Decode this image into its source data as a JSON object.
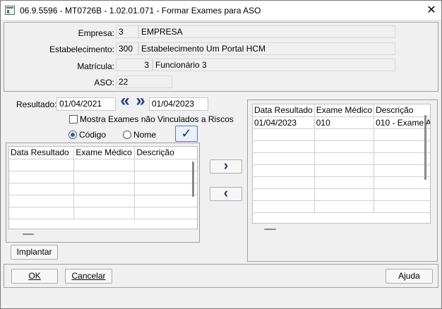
{
  "window": {
    "title": "06.9.5596 - MT0726B - 1.02.01.071 - Formar Exames para ASO"
  },
  "header": {
    "empresa_label": "Empresa:",
    "empresa_code": "3",
    "empresa_name": "EMPRESA",
    "estab_label": "Estabelecimento:",
    "estab_code": "300",
    "estab_name": "Estabelecimento Um Portal HCM",
    "matricula_label": "Matrícula:",
    "matricula_code": "3",
    "matricula_name": "Funcionário 3",
    "aso_label": "ASO:",
    "aso_value": "22"
  },
  "filter": {
    "resultado_label": "Resultado:",
    "date_from": "01/04/2021",
    "date_to": "01/04/2023",
    "prev_glyph": "«",
    "next_glyph": "»",
    "mostra_label": "Mostra Exames não Vinculados a Riscos",
    "codigo_label": "Código",
    "nome_label": "Nome",
    "confirm_glyph": "✓"
  },
  "left_grid": {
    "columns": [
      "Data Resultado",
      "Exame Médico",
      "Descrição"
    ],
    "rows": []
  },
  "right_grid": {
    "columns": [
      "Data Resultado",
      "Exame Médico",
      "Descrição"
    ],
    "rows": [
      [
        "01/04/2023",
        "010",
        "010 - Exame A"
      ]
    ]
  },
  "buttons": {
    "implantar": "Implantar",
    "move_right": "›",
    "move_left": "‹",
    "ok": "OK",
    "cancelar": "Cancelar",
    "ajuda": "Ajuda"
  }
}
